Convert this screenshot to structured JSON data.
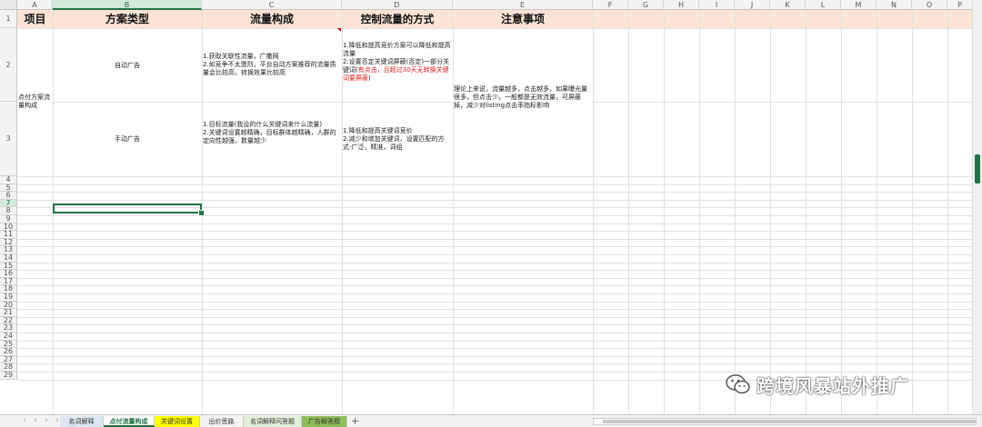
{
  "columns": [
    "A",
    "B",
    "C",
    "D",
    "E",
    "F",
    "G",
    "H",
    "I",
    "J",
    "K",
    "L",
    "M",
    "N",
    "O",
    "P"
  ],
  "selected_column": "B",
  "selected_row": "7",
  "rows": [
    "1",
    "2",
    "3",
    "4",
    "5",
    "6",
    "7",
    "8",
    "9",
    "10",
    "11",
    "12",
    "13",
    "14",
    "15",
    "16",
    "17",
    "18",
    "19",
    "20",
    "21",
    "22",
    "23",
    "24",
    "25",
    "26",
    "27",
    "28",
    "29"
  ],
  "header": {
    "a": "项目",
    "b": "方案类型",
    "c": "流量构成",
    "d": "控制流量的方式",
    "e": "注意事项"
  },
  "cells": {
    "a_merged": "点付方案流量构成",
    "b2": "自动广告",
    "b3": "手动广告",
    "c2": "1.获取关联性流量，广撒网\n2.如竞争不太激烈，平台自动方案推荐的流量质量会比较高，转换效果比较高",
    "c3": "1.目标流量(我设的什么关键词来什么流量)\n2.关键词设置越精确，目标群体越精确，人群的定向性越强，数量越少",
    "d2_main": "1.降低和提高竞价方案可以降低和提高流量\n2.设置否定关键词屏蔽(否定)一部分关键词(",
    "d2_red": "有点击，且超过30天无转换关键词要屏蔽",
    "d2_tail": ")",
    "d3": "1.降低和提高关键词竞价\n2.减少和增加关键词，设置匹配的方式-广泛，精准，词组",
    "e_merged": "理论上来说，流量越多，点击越多，如果曝光量很多，但点击少，一般都是无效流量，可屏蔽掉，减少对listing点击率指标影响"
  },
  "tabs": [
    {
      "label": "名词解释",
      "active": false
    },
    {
      "label": "点付流量构成",
      "active": true
    },
    {
      "label": "关键词设置",
      "active": false
    },
    {
      "label": "出价思路",
      "active": false
    },
    {
      "label": "名词解释问答题",
      "active": false
    },
    {
      "label": "广告解答题",
      "active": false
    }
  ],
  "tab_colors": {
    "active_text": "#217346",
    "yellow": "#ffff00",
    "green": "#8fbc5a",
    "header_band": "#fbe4d5",
    "selection": "#217346"
  },
  "watermark": {
    "text": "跨境风暴站外推广",
    "icon": "wechat-icon"
  }
}
